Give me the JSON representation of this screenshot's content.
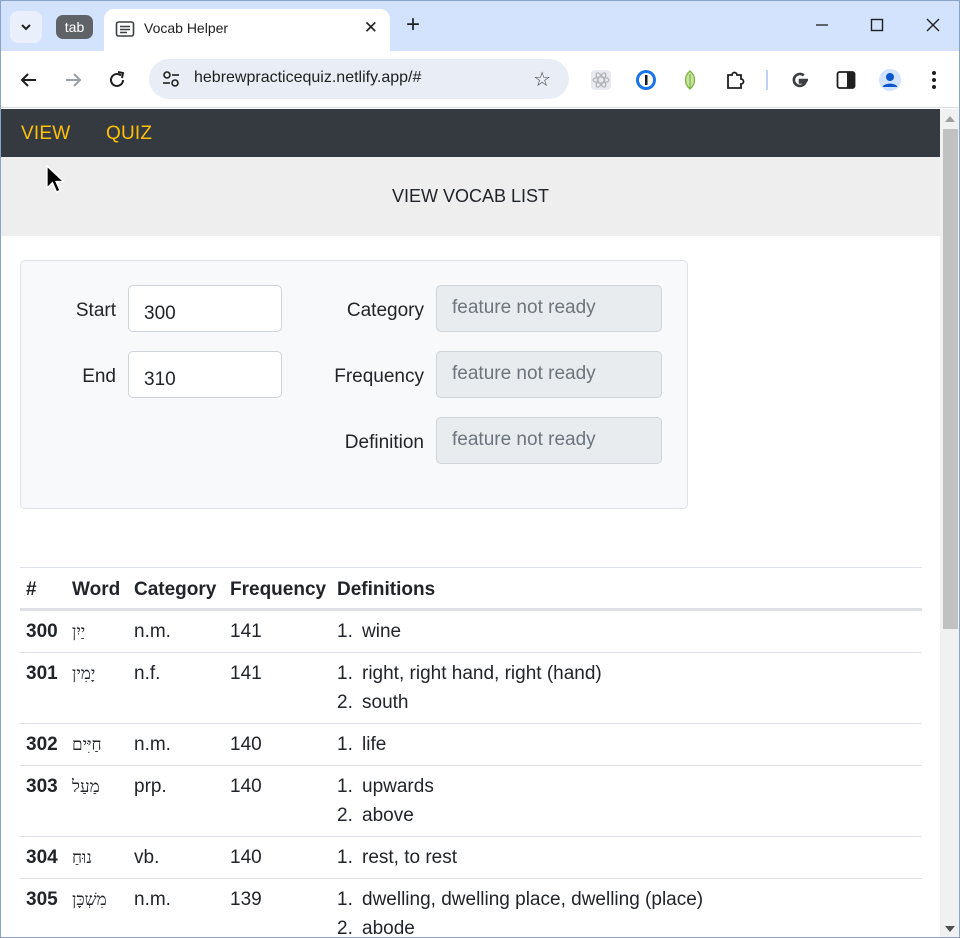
{
  "browser": {
    "tab_chip_label": "tab",
    "tab_title": "Vocab Helper",
    "url": "hebrewpracticequiz.netlify.app/#"
  },
  "nav": {
    "links": [
      "VIEW",
      "QUIZ"
    ]
  },
  "heading": "VIEW VOCAB LIST",
  "filters": {
    "start_label": "Start",
    "start_value": "300",
    "end_label": "End",
    "end_value": "310",
    "category_label": "Category",
    "frequency_label": "Frequency",
    "definition_label": "Definition",
    "disabled_placeholder": "feature not ready"
  },
  "table": {
    "headers": [
      "#",
      "Word",
      "Category",
      "Frequency",
      "Definitions"
    ],
    "rows": [
      {
        "num": "300",
        "word": "יַיִן",
        "category": "n.m.",
        "frequency": "141",
        "definitions": [
          "wine"
        ]
      },
      {
        "num": "301",
        "word": "יָמִין",
        "category": "n.f.",
        "frequency": "141",
        "definitions": [
          "right, right hand, right (hand)",
          "south"
        ]
      },
      {
        "num": "302",
        "word": "חַיִּים",
        "category": "n.m.",
        "frequency": "140",
        "definitions": [
          "life"
        ]
      },
      {
        "num": "303",
        "word": "מַעַל",
        "category": "prp.",
        "frequency": "140",
        "definitions": [
          "upwards",
          "above"
        ]
      },
      {
        "num": "304",
        "word": "נוּחַ",
        "category": "vb.",
        "frequency": "140",
        "definitions": [
          "rest, to rest"
        ]
      },
      {
        "num": "305",
        "word": "מִשְׁכָּן",
        "category": "n.m.",
        "frequency": "139",
        "definitions": [
          "dwelling, dwelling place, dwelling (place)",
          "abode"
        ]
      }
    ]
  }
}
